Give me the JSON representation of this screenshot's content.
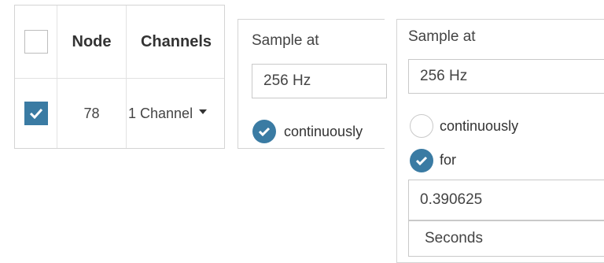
{
  "table": {
    "headers": {
      "node": "Node",
      "channels": "Channels"
    },
    "rows": [
      {
        "selected": true,
        "node": "78",
        "channels": "1 Channel"
      }
    ]
  },
  "sample_continuous": {
    "label": "Sample at",
    "rate": "256 Hz",
    "options": [
      {
        "label": "continuously",
        "selected": true
      }
    ]
  },
  "sample_for": {
    "label": "Sample at",
    "rate": "256 Hz",
    "options": [
      {
        "label": "continuously",
        "selected": false
      },
      {
        "label": "for",
        "selected": true
      }
    ],
    "duration": "0.390625",
    "unit": "Seconds"
  },
  "colors": {
    "accent": "#3a7ba3",
    "border": "#d4d4d4"
  }
}
